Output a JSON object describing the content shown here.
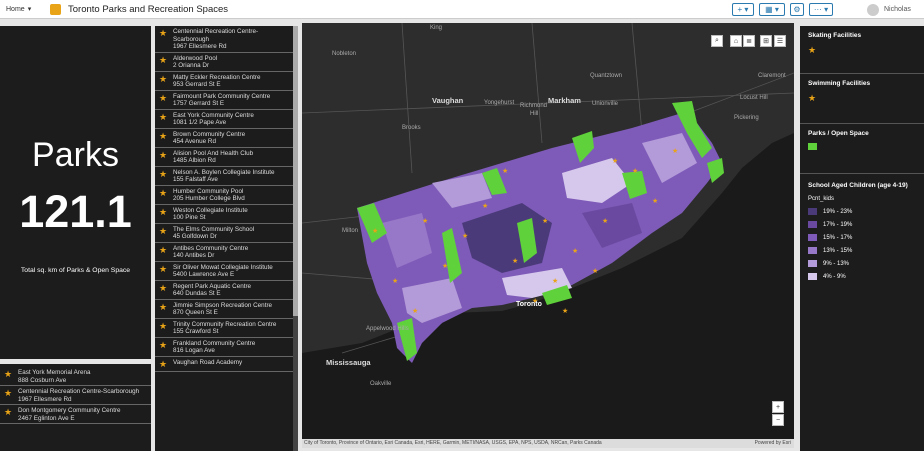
{
  "header": {
    "home_label": "Home",
    "home_caret": "▾",
    "title": "Toronto Parks and Recreation Spaces",
    "user_name": "Nicholas",
    "buttons": {
      "add": "+ ▾",
      "layout": "▦ ▾",
      "settings": "⚙",
      "more": "··· ▾"
    }
  },
  "indicator": {
    "title": "Parks",
    "value": "121.1",
    "subtitle": "Total sq. km of Parks & Open Space"
  },
  "bottom_list": [
    {
      "name": "East York Memorial Arena",
      "address": "888 Cosburn Ave"
    },
    {
      "name": "Centennial Recreation Centre-Scarborough",
      "address": "1967 Ellesmere Rd"
    },
    {
      "name": "Don Montgomery Community Centre",
      "address": "2467 Eglinton Ave E"
    }
  ],
  "mid_list": [
    {
      "name": "Centennial Recreation Centre-Scarborough",
      "address": "1967 Ellesmere Rd"
    },
    {
      "name": "Alderwood Pool",
      "address": "2 Orianna Dr"
    },
    {
      "name": "Matty Eckler Recreation Centre",
      "address": "953 Gerrard St E"
    },
    {
      "name": "Fairmount Park Community Centre",
      "address": "1757 Gerrard St E"
    },
    {
      "name": "East York Community Centre",
      "address": "1081 1/2 Pape Ave"
    },
    {
      "name": "Brown Community Centre",
      "address": "454 Avenue Rd"
    },
    {
      "name": "Alision Pool And Health Club",
      "address": "1485 Albion Rd"
    },
    {
      "name": "Nelson A. Boylen Collegiate Institute",
      "address": "155 Falstaff Ave"
    },
    {
      "name": "Humber Community Pool",
      "address": "205 Humber College Blvd"
    },
    {
      "name": "Weston Collegiate Institute",
      "address": "100 Pine St"
    },
    {
      "name": "The Elms Community School",
      "address": "45 Golfdown Dr"
    },
    {
      "name": "Antibes Community Centre",
      "address": "140 Antibes Dr"
    },
    {
      "name": "Sir Oliver Mowat Collegiate Institute",
      "address": "5400 Lawrence Ave E"
    },
    {
      "name": "Regent Park Aquatic Centre",
      "address": "640 Dundas St E"
    },
    {
      "name": "Jimmie Simpson Recreation Centre",
      "address": "870 Queen St E"
    },
    {
      "name": "Trinity Community Recreation Centre",
      "address": "155 Crawford St"
    },
    {
      "name": "Frankland Community Centre",
      "address": "816 Logan Ave"
    },
    {
      "name": "Vaughan Road Academy",
      "address": ""
    }
  ],
  "map": {
    "labels": {
      "king": "King",
      "nobleton": "Nobleton",
      "vaughan": "Vaughan",
      "markham": "Markham",
      "richmond": "Richmond",
      "hill": "Hill",
      "yonge": "Yongehurst",
      "unionville": "Unionville",
      "quantztown": "Quantztown",
      "locust": "Locust Hill",
      "pickering": "Pickering",
      "milton": "Milton",
      "mississauga": "Mississauga",
      "toronto": "Toronto",
      "oakville": "Oakville",
      "appleby": "Appelwood Hills",
      "brooks": "Brooks",
      "claremont": "Claremont"
    },
    "attribution": "City of Toronto, Province of Ontario, Esri Canada, Esri, HERE, Garmin, METI/NASA, USGS, EPA, NPS, USDA, NRCan, Parks Canada",
    "powered": "Powered by Esri",
    "zoom_in": "+",
    "zoom_out": "−"
  },
  "legend": {
    "skating": "Skating Facilities",
    "swimming": "Swimming Facilities",
    "parks": "Parks / Open Space",
    "school": "School Aged Children (age 4-19)",
    "field": "Pcnt_kids",
    "classes": [
      {
        "label": "19% - 23%",
        "color": "#4b3a7a"
      },
      {
        "label": "17% - 19%",
        "color": "#6a4aa0"
      },
      {
        "label": "15% - 17%",
        "color": "#7e5bb8"
      },
      {
        "label": "13% - 15%",
        "color": "#9677c8"
      },
      {
        "label": "9% - 13%",
        "color": "#b39ad8"
      },
      {
        "label": "4% - 9%",
        "color": "#d6c8ec"
      }
    ],
    "park_color": "#5fd13a",
    "star_color": "#e8a317"
  }
}
